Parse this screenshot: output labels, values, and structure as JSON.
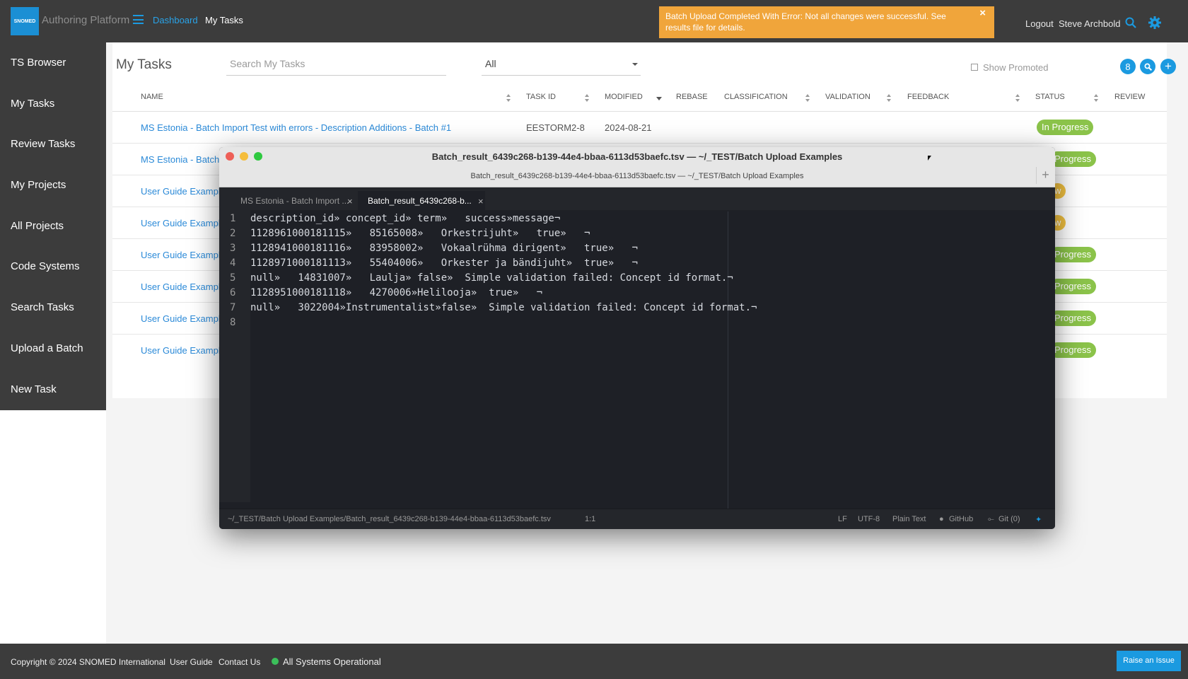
{
  "header": {
    "logo_text": "SNOMED",
    "app_title": "Authoring Platform",
    "nav_dashboard": "Dashboard",
    "nav_mytasks": "My Tasks",
    "toast": "Batch Upload Completed With Error: Not all changes were successful. See results file for details.",
    "toast_close": "×",
    "logout": "Logout",
    "user": "Steve Archbold",
    "accent": "#1b9ae0",
    "icons": [
      "menu-icon",
      "search-icon",
      "gear-icon"
    ]
  },
  "sidebar": {
    "items": [
      {
        "label": "TS Browser"
      },
      {
        "label": "My Tasks"
      },
      {
        "label": "Review Tasks"
      },
      {
        "label": "My Projects"
      },
      {
        "label": "All Projects"
      },
      {
        "label": "Code Systems"
      },
      {
        "label": "Search Tasks"
      },
      {
        "label": "Upload a Batch"
      },
      {
        "label": "New Task"
      }
    ]
  },
  "main": {
    "title": "My Tasks",
    "search_placeholder": "Search My Tasks",
    "filter_value": "All",
    "show_promoted": "Show Promoted",
    "count_badge": "8",
    "columns": [
      "NAME",
      "TASK ID",
      "MODIFIED",
      "REBASE",
      "CLASSIFICATION",
      "VALIDATION",
      "FEEDBACK",
      "STATUS",
      "REVIEW"
    ],
    "rows": [
      {
        "name": "MS Estonia - Batch Import Test with errors - Description Additions - Batch #1",
        "task_id": "EESTORM2-8",
        "modified": "2024-08-21",
        "status": "In Progress"
      },
      {
        "name": "MS Estonia - Batch",
        "status": "Progress"
      },
      {
        "name": "User Guide Exampl",
        "status": "w"
      },
      {
        "name": "User Guide Exampl",
        "status": "w"
      },
      {
        "name": "User Guide Exampl",
        "status": "Progress"
      },
      {
        "name": "User Guide Exampl",
        "status": "Progress"
      },
      {
        "name": "User Guide Exampl",
        "status": "Progress"
      },
      {
        "name": "User Guide Exampl",
        "status": "Progress"
      }
    ]
  },
  "editor": {
    "title": "Batch_result_6439c268-b139-44e4-bbaa-6113d53baefc.tsv — ~/_TEST/Batch Upload Examples",
    "subtitle": "Batch_result_6439c268-b139-44e4-bbaa-6113d53baefc.tsv — ~/_TEST/Batch Upload Examples",
    "tabs": [
      {
        "label": "MS Estonia - Batch Import ..."
      },
      {
        "label": "Batch_result_6439c268-b..."
      }
    ],
    "lines": [
      "description_id» concept_id» term»   success»message¬",
      "1128961000181115»   85165008»   Orkestrijuht»   true»   ¬",
      "1128941000181116»   83958002»   Vokaalrühma dirigent»   true»   ¬",
      "1128971000181113»   55404006»   Orkester ja bändijuht»  true»   ¬",
      "null»   14831007»   Laulja» false»  Simple validation failed: Concept id format.¬",
      "1128951000181118»   4270006»Helilooja»  true»   ¬",
      "null»   3022004»Instrumentalist»false»  Simple validation failed: Concept id format.¬",
      ""
    ],
    "line_numbers": [
      "1",
      "2",
      "3",
      "4",
      "5",
      "6",
      "7",
      "8"
    ],
    "status_path": "~/_TEST/Batch Upload Examples/Batch_result_6439c268-b139-44e4-bbaa-6113d53baefc.tsv",
    "status_pos": "1:1",
    "status_lf": "LF",
    "status_enc": "UTF-8",
    "status_grammar": "Plain Text",
    "status_github": "GitHub",
    "status_git": "Git (0)"
  },
  "footer": {
    "copyright": "Copyright © 2024 SNOMED International",
    "user_guide": "User Guide",
    "contact": "Contact Us",
    "system_status": "All Systems Operational",
    "raise_issue": "Raise an Issue"
  }
}
